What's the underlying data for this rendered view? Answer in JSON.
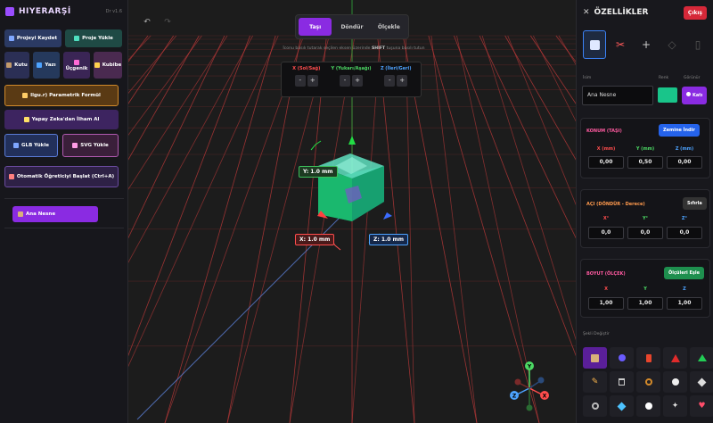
{
  "left_panel": {
    "title": "HIYERARŞİ",
    "version": "Dr v1.6",
    "buttons": {
      "save_project": "Projeyi Kaydet",
      "load_project": "Proje Yükle",
      "box": "Kutu",
      "text": "Yazı",
      "triangle": "Üçgenik",
      "rubik": "Kubibe",
      "parametric": "Ilgu.r) Parametrik Formül",
      "ai_shape": "Yapay Zeka'dan İlham Al",
      "load_glb": "GLB Yükle",
      "load_svg": "SVG Yükle",
      "auto_teach": "Otomatik Öğreticiyi Başlat (Ctrl+A)"
    },
    "tree_items": [
      "Ana Nesne"
    ]
  },
  "viewport": {
    "mode_tabs": [
      "Taşı",
      "Döndür",
      "Ölçekle"
    ],
    "active_mode": "Taşı",
    "hint_prefix": "İconu basılı tutarak seçilen eksen üzerinde",
    "hint_key": "SHIFT",
    "hint_suffix": "tuşuna basılı tutun",
    "axis_controls": [
      {
        "label": "X (Sol/Sağ)",
        "color": "#ff4d4d",
        "minus": "-",
        "plus": "+"
      },
      {
        "label": "Y (Yukarı/Aşağı)",
        "color": "#4cd964",
        "minus": "-",
        "plus": "+"
      },
      {
        "label": "Z (İleri/Geri)",
        "color": "#4da3ff",
        "minus": "-",
        "plus": "+"
      }
    ],
    "dimension_labels": {
      "y": "Y: 1.0 mm",
      "x": "X: 1.0 mm",
      "z": "Z: 1.0 mm"
    },
    "gizmo_axes": [
      "Y",
      "X",
      "Z"
    ]
  },
  "right_panel": {
    "title": "ÖZELLİKLER",
    "close_label": "Çıkış",
    "name_label": "İsim",
    "name_value": "Ana Nesne",
    "color_label": "Renk",
    "color_value": "#19c58a",
    "visibility_label": "Görünür",
    "visibility_btn": "Katı",
    "position": {
      "title": "KONUM (TAŞI)",
      "action": "Zemine İndir",
      "labels": [
        "X (mm)",
        "Y (mm)",
        "Z (mm)"
      ],
      "values": [
        "0,00",
        "0,50",
        "0,00"
      ]
    },
    "rotation": {
      "title": "AÇI (DÖNDÜR - Derece)",
      "action": "Sıfırla",
      "labels": [
        "X°",
        "Y°",
        "Z°"
      ],
      "values": [
        "0,0",
        "0,0",
        "0,0"
      ]
    },
    "size": {
      "title": "BOYUT (ÖLÇEK)",
      "action": "Ölçüleri Eşle",
      "labels": [
        "X",
        "Y",
        "Z"
      ],
      "values": [
        "1,00",
        "1,00",
        "1,00"
      ]
    },
    "shapes_label": "Şekli Değiştir"
  },
  "colors": {
    "accent": "#8a2be2",
    "x_axis": "#ff4d4d",
    "y_axis": "#4cd964",
    "z_axis": "#4da3ff"
  }
}
